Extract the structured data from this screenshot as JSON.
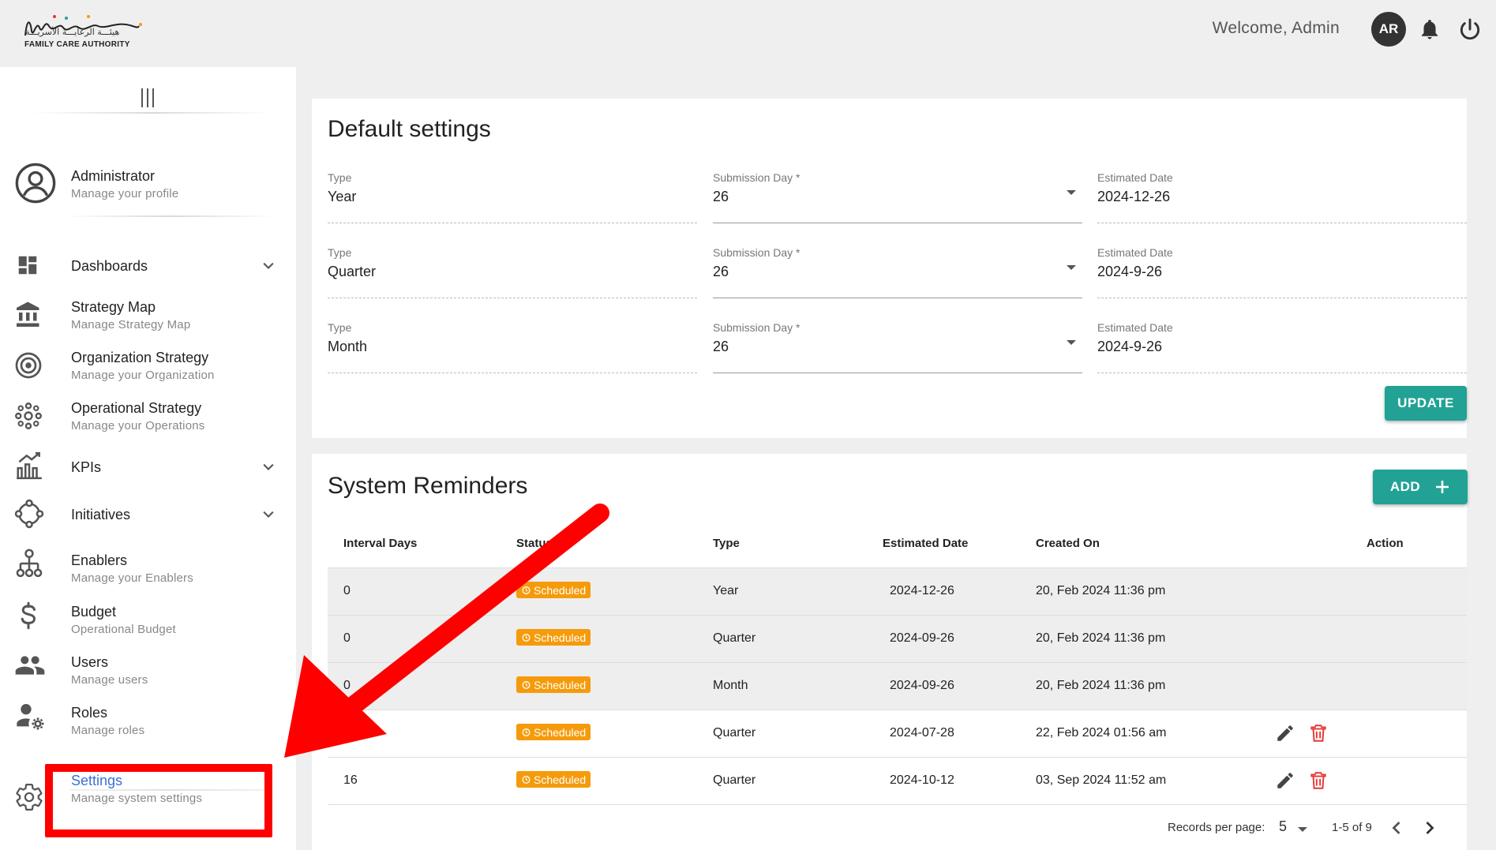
{
  "header": {
    "logo_ar": "هيئـــة الرعايـــة الأسريـــة",
    "logo_en": "FAMILY CARE AUTHORITY",
    "welcome": "Welcome,  Admin",
    "avatar_initials": "AR"
  },
  "sidebar": {
    "profile": {
      "title": "Administrator",
      "subtitle": "Manage your profile"
    },
    "items": [
      {
        "title": "Dashboards",
        "subtitle": "",
        "icon": "dashboard-icon",
        "expandable": true
      },
      {
        "title": "Strat​egy Map",
        "subtitle": "Manage Strat​egy Map",
        "icon": "bank-icon",
        "expandable": false
      },
      {
        "title": "Organization Strat​egy",
        "subtitle": "Manage your Organization",
        "icon": "target-icon",
        "expandable": false
      },
      {
        "title": "Operational Strat​egy",
        "subtitle": "Manage your Operations",
        "icon": "hub-icon",
        "expandable": false
      },
      {
        "title": "KPIs",
        "subtitle": "",
        "icon": "chart-growth-icon",
        "expandable": true
      },
      {
        "title": "Initiatives",
        "subtitle": "",
        "icon": "cycle-icon",
        "expandable": true
      },
      {
        "title": "Enablers",
        "subtitle": "Manage your Enablers",
        "icon": "org-tree-icon",
        "expandable": false
      },
      {
        "title": "Budget",
        "subtitle": "Operational Budget",
        "icon": "dollar-icon",
        "expandable": false
      },
      {
        "title": "Users",
        "subtitle": "Manage users",
        "icon": "users-icon",
        "expandable": false
      },
      {
        "title": "Roles",
        "subtitle": "Manage roles",
        "icon": "user-gear-icon",
        "expandable": false
      }
    ],
    "settings": {
      "title": "Settings",
      "subtitle": "Manage system settings"
    }
  },
  "default_settings": {
    "title": "Default settings",
    "type_label": "Type",
    "day_label": "Submission Day *",
    "date_label": "Estimated Date",
    "rows": [
      {
        "type": "Year",
        "day": "26",
        "date": "2024-12-26"
      },
      {
        "type": "Quarter",
        "day": "26",
        "date": "2024-9-26"
      },
      {
        "type": "Month",
        "day": "26",
        "date": "2024-9-26"
      }
    ],
    "update_label": "UPDATE"
  },
  "reminders": {
    "title": "System Reminders",
    "add_label": "ADD",
    "columns": [
      "Interval Days",
      "Status",
      "Type",
      "Estimated Date",
      "Created On",
      "Action"
    ],
    "rows": [
      {
        "interval": "0",
        "status": "Scheduled",
        "type": "Year",
        "date": "2024-12-26",
        "created": "20, Feb 2024 11:36 pm",
        "actions": false
      },
      {
        "interval": "0",
        "status": "Scheduled",
        "type": "Quarter",
        "date": "2024-09-26",
        "created": "20, Feb 2024 11:36 pm",
        "actions": false
      },
      {
        "interval": "0",
        "status": "Scheduled",
        "type": "Month",
        "date": "2024-09-26",
        "created": "20, Feb 2024 11:36 pm",
        "actions": false
      },
      {
        "interval": "60",
        "status": "Scheduled",
        "type": "Quarter",
        "date": "2024-07-28",
        "created": "22, Feb 2024 01:56 am",
        "actions": true
      },
      {
        "interval": "16",
        "status": "Scheduled",
        "type": "Quarter",
        "date": "2024-10-12",
        "created": "03, Sep 2024 11:52 am",
        "actions": true
      }
    ],
    "pagination": {
      "label": "Records per page:",
      "per_page": "5",
      "range": "1-5 of 9"
    }
  },
  "colors": {
    "accent": "#22a295",
    "badge": "#f59b0b",
    "annotation": "#ff0000",
    "delete": "#e53935",
    "link": "#3a6fd8"
  }
}
